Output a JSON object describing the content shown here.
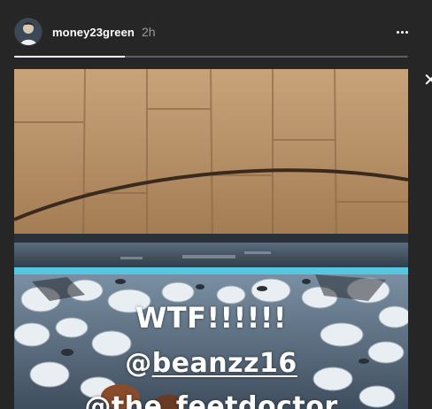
{
  "story": {
    "username": "money23green",
    "time_ago": "2h",
    "progress": 0.28,
    "more_icon": "ellipsis-icon",
    "close_icon": "close-icon"
  },
  "media": {
    "captions": {
      "line1": "WTF!!!!!!",
      "line2_prefix": "@",
      "line2_handle": "beanzz16",
      "line3": "@the_feetdoctor"
    }
  }
}
